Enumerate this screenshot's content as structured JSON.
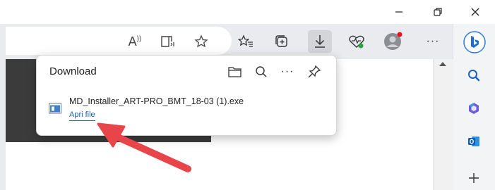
{
  "window": {
    "minimize_icon": "minimize-icon",
    "restore_icon": "restore-icon",
    "close_icon": "close-icon"
  },
  "toolbar": {
    "icons": [
      "read-aloud-icon",
      "immersive-reader-icon",
      "favorite-star-icon",
      "favorites-icon",
      "collections-icon",
      "downloads-icon",
      "browser-essentials-icon",
      "profile-icon",
      "more-icon"
    ],
    "read_aloud_glyph": "A",
    "notification_color": "#e81123"
  },
  "sidebar": {
    "icons": [
      "bing-icon",
      "search-icon",
      "copilot-icon",
      "outlook-icon",
      "add-icon"
    ]
  },
  "downloads_panel": {
    "title": "Download",
    "actions": [
      "open-folder-icon",
      "search-icon",
      "more-options-icon",
      "pin-icon"
    ],
    "items": [
      {
        "file_name": "MD_Installer_ART-PRO_BMT_18-03 (1).exe",
        "action_label": "Apri file"
      }
    ]
  },
  "colors": {
    "accent": "#1a5fb4",
    "annotation_arrow": "#e8454a"
  }
}
